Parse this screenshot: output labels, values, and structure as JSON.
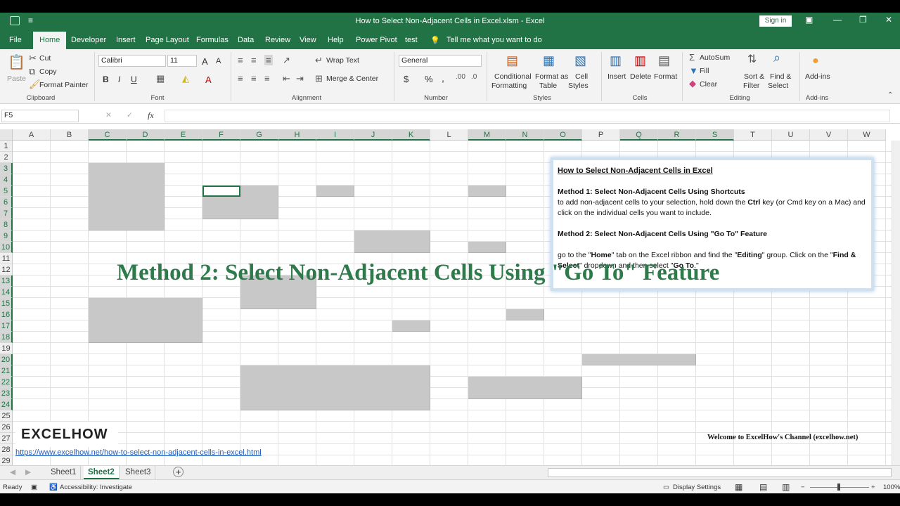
{
  "window": {
    "title": "How to Select Non-Adjacent Cells in Excel.xlsm  -  Excel",
    "sign_in": "Sign in"
  },
  "menu": {
    "tabs": [
      "File",
      "Home",
      "Developer",
      "Insert",
      "Page Layout",
      "Formulas",
      "Data",
      "Review",
      "View",
      "Help",
      "Power Pivot",
      "test"
    ],
    "active": "Home",
    "tell_me": "Tell me what you want to do"
  },
  "ribbon": {
    "clipboard": {
      "paste": "Paste",
      "cut": "Cut",
      "copy": "Copy",
      "format_painter": "Format Painter",
      "group": "Clipboard"
    },
    "font": {
      "name": "Calibri",
      "size": "11",
      "bold": "B",
      "italic": "I",
      "underline": "U",
      "grow": "A",
      "shrink": "A",
      "font_color": "A",
      "group": "Font"
    },
    "alignment": {
      "wrap_text": "Wrap Text",
      "merge_center": "Merge & Center",
      "group": "Alignment"
    },
    "number": {
      "format": "General",
      "currency": "$",
      "percent": "%",
      "comma": ",",
      "group": "Number"
    },
    "styles": {
      "conditional": "Conditional",
      "conditional2": "Formatting",
      "format_as": "Format as",
      "format_as2": "Table",
      "cell": "Cell",
      "cell2": "Styles",
      "group": "Styles"
    },
    "cells": {
      "insert": "Insert",
      "delete": "Delete",
      "format": "Format",
      "group": "Cells"
    },
    "editing": {
      "autosum": "AutoSum",
      "fill": "Fill",
      "clear": "Clear",
      "sort": "Sort &",
      "sort2": "Filter",
      "find": "Find &",
      "find2": "Select",
      "group": "Editing"
    },
    "addins": {
      "label": "Add-ins",
      "group": "Add-ins"
    }
  },
  "formula_bar": {
    "name_box": "F5",
    "fx": "fx",
    "cancel": "✕",
    "enter": "✓",
    "value": ""
  },
  "grid": {
    "columns": [
      "A",
      "B",
      "C",
      "D",
      "E",
      "F",
      "G",
      "H",
      "I",
      "J",
      "K",
      "L",
      "M",
      "N",
      "O",
      "P",
      "Q",
      "R",
      "S",
      "T",
      "U",
      "V",
      "W"
    ],
    "rows": [
      "1",
      "2",
      "3",
      "4",
      "5",
      "6",
      "7",
      "8",
      "9",
      "10",
      "11",
      "12",
      "13",
      "14",
      "15",
      "16",
      "17",
      "18",
      "19",
      "20",
      "21",
      "22",
      "23",
      "24",
      "25",
      "26",
      "27",
      "28",
      "29"
    ],
    "selected_columns": [
      "C",
      "D",
      "E",
      "F",
      "G",
      "H",
      "I",
      "J",
      "K",
      "M",
      "N",
      "O",
      "Q",
      "R",
      "S"
    ],
    "selected_rows": [
      "3",
      "4",
      "5",
      "6",
      "7",
      "8",
      "9",
      "10",
      "13",
      "14",
      "15",
      "16",
      "17",
      "18",
      "20",
      "21",
      "22",
      "23",
      "24"
    ],
    "active_cell": "F5"
  },
  "note": {
    "title": "How to Select Non-Adjacent Cells in Excel",
    "m1_title": "Method 1: Select Non-Adjacent Cells Using Shortcuts",
    "m1_a": "to add non-adjacent cells to your selection, hold down the ",
    "m1_ctrl": "Ctrl",
    "m1_b": " key (or Cmd key on a Mac) and click on the individual cells you want to include.",
    "m2_title": "Method 2: Select Non-Adjacent Cells Using \"Go To\" Feature",
    "m2_a": "go to the \"",
    "m2_home": "Home",
    "m2_b": "\" tab on the Excel ribbon and find the \"",
    "m2_editing": "Editing",
    "m2_c": "\" group. Click on the \"",
    "m2_find": "Find & Select",
    "m2_d": "\" dropdown and then select \"",
    "m2_goto": "Go To",
    "m2_e": ".\""
  },
  "overlay_text": "Method 2: Select Non-Adjacent Cells Using \"Go To\" Feature",
  "logo": "EXCELHOW",
  "link": "https://www.excelhow.net/how-to-select-non-adjacent-cells-in-excel.html",
  "welcome": "Welcome to ExcelHow's  Channel (excelhow.net)",
  "sheets": {
    "tabs": [
      "Sheet1",
      "Sheet2",
      "Sheet3"
    ],
    "active": "Sheet2",
    "add": "+"
  },
  "status": {
    "ready": "Ready",
    "accessibility": "Accessibility: Investigate",
    "display_settings": "Display Settings",
    "zoom": "100%"
  }
}
